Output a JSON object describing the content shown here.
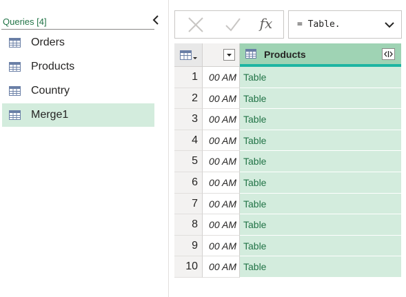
{
  "queries": {
    "header": "Queries [4]",
    "items": [
      {
        "label": "Orders",
        "icon": "table-icon",
        "selected": false
      },
      {
        "label": "Products",
        "icon": "table-icon",
        "selected": false
      },
      {
        "label": "Country",
        "icon": "table-icon",
        "selected": false
      },
      {
        "label": "Merge1",
        "icon": "table-icon",
        "selected": true
      }
    ]
  },
  "formula_bar": {
    "cancel_icon": "cancel-icon",
    "commit_icon": "checkmark-icon",
    "fx_label": "fx",
    "formula": "= Table.",
    "expand_icon": "chevron-down-icon"
  },
  "grid": {
    "corner_icon": "table-menu-icon",
    "columns": [
      {
        "name": "",
        "type": "datetime"
      },
      {
        "name": "Products",
        "type": "table",
        "selected": true
      }
    ],
    "rows": [
      {
        "num": "1",
        "time": "00 AM",
        "value": "Table"
      },
      {
        "num": "2",
        "time": "00 AM",
        "value": "Table"
      },
      {
        "num": "3",
        "time": "00 AM",
        "value": "Table"
      },
      {
        "num": "4",
        "time": "00 AM",
        "value": "Table"
      },
      {
        "num": "5",
        "time": "00 AM",
        "value": "Table"
      },
      {
        "num": "6",
        "time": "00 AM",
        "value": "Table"
      },
      {
        "num": "7",
        "time": "00 AM",
        "value": "Table"
      },
      {
        "num": "8",
        "time": "00 AM",
        "value": "Table"
      },
      {
        "num": "9",
        "time": "00 AM",
        "value": "Table"
      },
      {
        "num": "10",
        "time": "00 AM",
        "value": "Table"
      }
    ]
  },
  "colors": {
    "accent": "#217346",
    "selected_bg": "#d3ecdd",
    "header_selected": "#9fd3b4",
    "header_bar": "#1db5a2"
  }
}
